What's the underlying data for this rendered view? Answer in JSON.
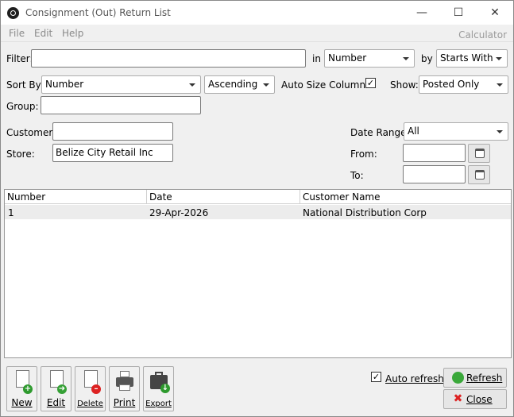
{
  "window": {
    "title": "Consignment (Out) Return List"
  },
  "menu": {
    "file": "File",
    "edit": "Edit",
    "help": "Help",
    "calculator": "Calculator"
  },
  "filter": {
    "label": "Filter:",
    "value": "",
    "in_label": "in",
    "in_value": "Number",
    "by_label": "by",
    "by_value": "Starts With"
  },
  "sort": {
    "label": "Sort By:",
    "value": "Number",
    "order": "Ascending",
    "auto_size_label": "Auto Size Columns",
    "auto_size_checked": true,
    "show_label": "Show:",
    "show_value": "Posted Only"
  },
  "group": {
    "label": "Group:",
    "value": ""
  },
  "customer": {
    "label": "Customer:",
    "value": ""
  },
  "store": {
    "label": "Store:",
    "value": "Belize City Retail Inc"
  },
  "date": {
    "range_label": "Date Range:",
    "range_value": "All",
    "from_label": "From:",
    "from_value": "",
    "to_label": "To:",
    "to_value": ""
  },
  "grid": {
    "columns": [
      "Number",
      "Date",
      "Customer Name"
    ],
    "rows": [
      [
        "1",
        "29-Apr-2026",
        "National Distribution Corp"
      ]
    ]
  },
  "toolbar": {
    "new": "New",
    "edit": "Edit",
    "delete": "Delete",
    "print": "Print",
    "export": "Export"
  },
  "bottom": {
    "auto_refresh_label": "Auto refresh",
    "auto_refresh_checked": true,
    "refresh": "Refresh",
    "close": "Close"
  }
}
